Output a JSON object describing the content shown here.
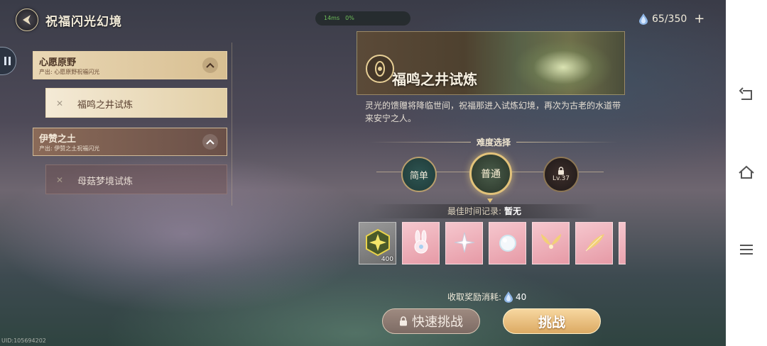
{
  "header": {
    "title": "祝福闪光幻境",
    "status": {
      "network": "14ms",
      "battery": "0%"
    },
    "currency": {
      "value": "65/350",
      "add": "+"
    }
  },
  "left_list": {
    "categories": [
      {
        "title": "心愿原野",
        "subtitle": "产出: 心愿原野祝福闪光",
        "trial": "福鸣之井试炼",
        "trial_mark": "✕"
      },
      {
        "title": "伊赞之土",
        "subtitle": "产出: 伊赞之土祝福闪光",
        "trial": "母菇梦境试炼",
        "trial_mark": "✕"
      }
    ]
  },
  "detail": {
    "trial_title": "福鸣之井试炼",
    "description": "灵光的馈赠将降临世间，祝福那进入试炼幻境，再次为古老的水道带来安宁之人。",
    "difficulty_title": "难度选择",
    "difficulties": [
      {
        "label": "简单"
      },
      {
        "label": "普通",
        "selected": true
      },
      {
        "label": "Lv.37",
        "locked": true
      }
    ],
    "best_time_label": "最佳时间记录:",
    "best_time_value": "暂无",
    "reward_first_count": "400",
    "cost_label": "收取奖励消耗:",
    "cost_value": "40",
    "quick_challenge": "快速挑战",
    "challenge": "挑战"
  },
  "footer": {
    "uid": "UID:105694202"
  },
  "colors": {
    "gold": "#e2c27a",
    "pink_card": "#f0b4be",
    "panel_light": "#e9d7b4"
  }
}
